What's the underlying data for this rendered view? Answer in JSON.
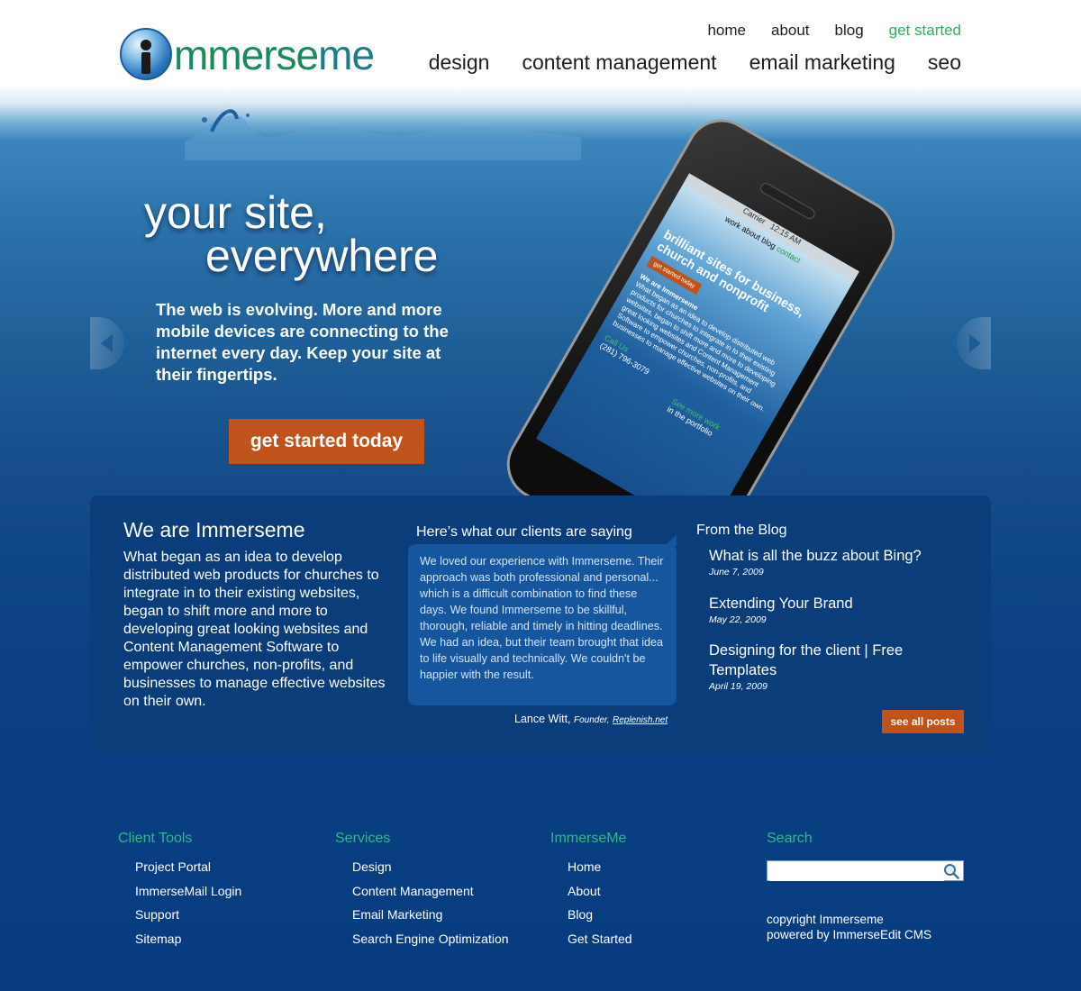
{
  "brand": {
    "logo_part1": "mmerse",
    "logo_part2": "me",
    "accent": "#2fb05a",
    "cta_color": "#c0521b"
  },
  "nav": {
    "top": [
      "home",
      "about",
      "blog",
      "get started"
    ],
    "main": [
      "design",
      "content management",
      "email marketing",
      "seo"
    ]
  },
  "hero": {
    "title_line1": "your site,",
    "title_line2": "everywhere",
    "text": "The web is evolving. More and more mobile devices are connecting to the internet  every day. Keep your site at their fingertips.",
    "cta": "get started today",
    "prev_icon": "chevron-left-icon",
    "next_icon": "chevron-right-icon"
  },
  "phone_screen": {
    "status_carrier": "Carrier",
    "status_time": "12:15 AM",
    "nav": [
      "work",
      "about",
      "blog",
      "contact"
    ],
    "title": "brilliant sites for business, church and nonprofit",
    "cta": "get started today",
    "heading": "We are Immerseme",
    "body": "What began as an idea to develop distributed web products for churches to integrate in to their existing websites, began to shift more and more to developing great looking websites and Content Management Software to empower churches, non-profits, and businesses to manage effective websites on their own.",
    "call": "Call Us",
    "phone": "(281) 796-3079",
    "more": "See more work",
    "more_sub": "in the portfolio"
  },
  "about": {
    "heading": "We are Immerseme",
    "text": "What began as an idea to develop distributed web products for churches to integrate in to their existing websites, began to shift more and more to developing great looking websites and Content Management Software to empower churches, non-profits, and businesses to manage effective websites on their own."
  },
  "testimonial": {
    "heading": "Here’s what our clients are saying",
    "quote": "We loved our experience with Immerseme. Their approach was both professional and personal... which is a difficult combination to find these days. We found Immerseme to be skillful, thorough, reliable and timely in hitting deadlines.  We had an idea, but their team brought that idea to life visually and technically.  We couldn't be happier with the result.",
    "name": "Lance Witt,",
    "role": "Founder,",
    "company": "Replenish.net"
  },
  "blog": {
    "heading": "From the Blog",
    "posts": [
      {
        "title": "What is all the buzz about Bing?",
        "date": "June 7, 2009"
      },
      {
        "title": "Extending Your Brand",
        "date": "May 22, 2009"
      },
      {
        "title": "Designing for the client | Free Templates",
        "date": "April 19, 2009"
      }
    ],
    "see_all": "see all posts"
  },
  "footer": {
    "client_tools": {
      "heading": "Client Tools",
      "links": [
        "Project Portal",
        "ImmerseMail Login",
        "Support",
        "Sitemap"
      ]
    },
    "services": {
      "heading": "Services",
      "links": [
        "Design",
        "Content Management",
        "Email Marketing",
        "Search Engine Optimization"
      ]
    },
    "immerseme": {
      "heading": "ImmerseMe",
      "links": [
        "Home",
        "About",
        "Blog",
        "Get Started"
      ]
    },
    "search": {
      "heading": "Search",
      "placeholder": "",
      "icon": "search-icon"
    },
    "copyright": "copyright Immerseme",
    "powered": "powered by ImmerseEdit CMS"
  }
}
